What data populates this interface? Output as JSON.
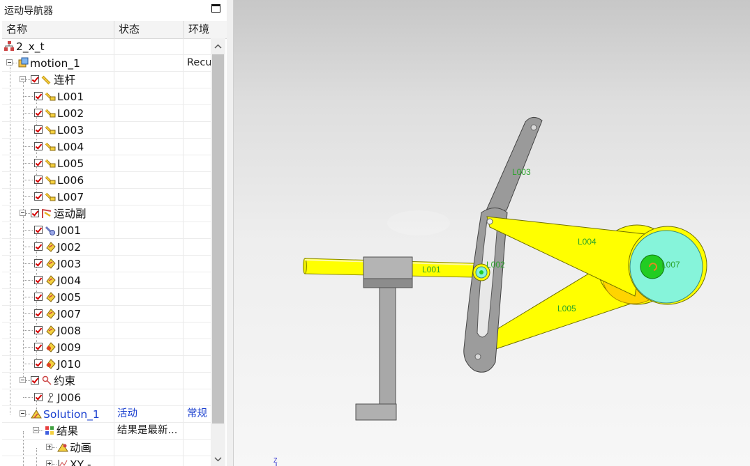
{
  "navigator": {
    "title": "运动导航器",
    "columns": [
      "名称",
      "状态",
      "环境"
    ],
    "rows": [
      {
        "name": "2_x_t",
        "status": "",
        "env": "",
        "icon": "assembly-icon"
      },
      {
        "name": "motion_1",
        "status": "",
        "env": "Recu",
        "icon": "motion-sim-icon"
      },
      {
        "name": "连杆",
        "status": "",
        "env": "",
        "icon": "links-folder-icon"
      },
      {
        "name": "L001",
        "status": "",
        "env": "",
        "icon": "link-icon"
      },
      {
        "name": "L002",
        "status": "",
        "env": "",
        "icon": "link-icon"
      },
      {
        "name": "L003",
        "status": "",
        "env": "",
        "icon": "link-icon"
      },
      {
        "name": "L004",
        "status": "",
        "env": "",
        "icon": "link-icon"
      },
      {
        "name": "L005",
        "status": "",
        "env": "",
        "icon": "link-icon"
      },
      {
        "name": "L006",
        "status": "",
        "env": "",
        "icon": "link-icon"
      },
      {
        "name": "L007",
        "status": "",
        "env": "",
        "icon": "link-icon"
      },
      {
        "name": "运动副",
        "status": "",
        "env": "",
        "icon": "joints-folder-icon"
      },
      {
        "name": "J001",
        "status": "",
        "env": "",
        "icon": "fixed-joint-icon"
      },
      {
        "name": "J002",
        "status": "",
        "env": "",
        "icon": "joint-icon"
      },
      {
        "name": "J003",
        "status": "",
        "env": "",
        "icon": "joint-icon"
      },
      {
        "name": "J004",
        "status": "",
        "env": "",
        "icon": "joint-icon"
      },
      {
        "name": "J005",
        "status": "",
        "env": "",
        "icon": "joint-icon"
      },
      {
        "name": "J007",
        "status": "",
        "env": "",
        "icon": "joint-icon"
      },
      {
        "name": "J008",
        "status": "",
        "env": "",
        "icon": "joint-icon"
      },
      {
        "name": "J009",
        "status": "",
        "env": "",
        "icon": "driver-joint-icon"
      },
      {
        "name": "J010",
        "status": "",
        "env": "",
        "icon": "driver-joint-icon"
      },
      {
        "name": "约束",
        "status": "",
        "env": "",
        "icon": "constraints-folder-icon"
      },
      {
        "name": "J006",
        "status": "",
        "env": "",
        "icon": "constraint-icon"
      },
      {
        "name": "Solution_1",
        "status": "活动",
        "env": "常规",
        "icon": "solution-icon"
      },
      {
        "name": "结果",
        "status": "结果是最新...",
        "env": "",
        "icon": "results-icon"
      },
      {
        "name": "动画",
        "status": "",
        "env": "",
        "icon": "animation-icon"
      },
      {
        "name": "XY -",
        "status": "",
        "env": "",
        "icon": "xy-graph-icon"
      }
    ]
  },
  "viewport": {
    "labels": {
      "l001": "L001",
      "l002": "L002",
      "l003": "L003",
      "l004": "L004",
      "l005": "L005",
      "l007": "L007"
    },
    "axis_label": "Z",
    "colors": {
      "yellow": "#ffff00",
      "gray": "#a6a6a6",
      "cyan": "#86f4da",
      "green": "#22cc22",
      "label_green": "#2aa42a"
    }
  }
}
